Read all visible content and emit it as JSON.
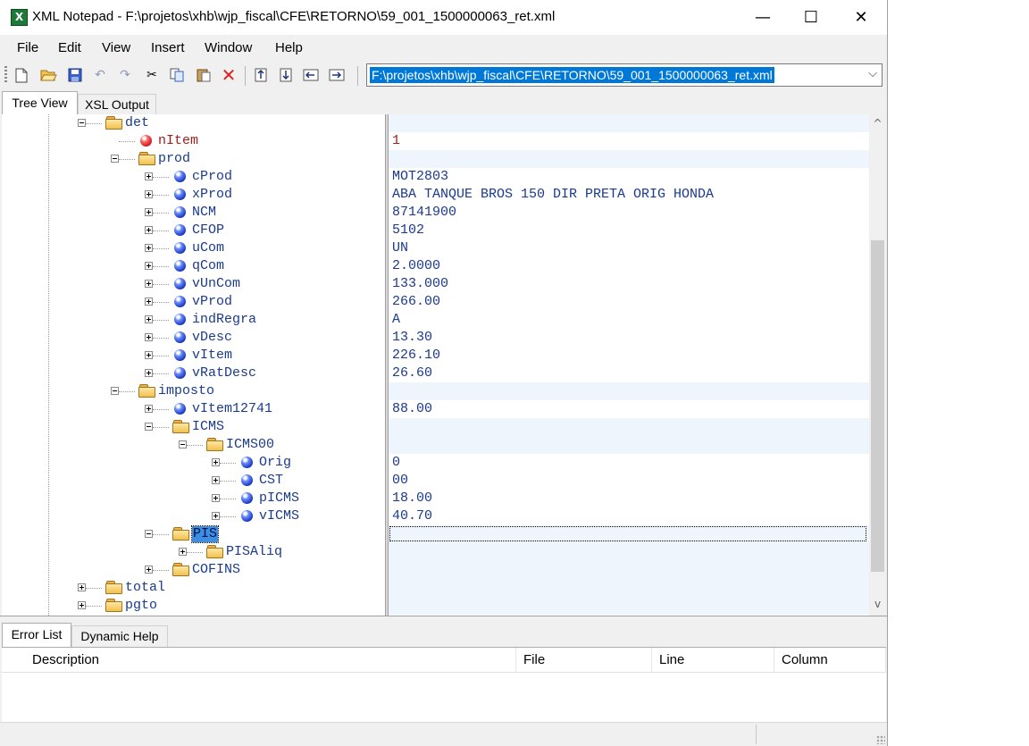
{
  "window": {
    "title": "XML Notepad - F:\\projetos\\xhb\\wjp_fiscal\\CFE\\RETORNO\\59_001_1500000063_ret.xml",
    "app_icon_letter": "X",
    "minimize_glyph": "—",
    "maximize_glyph": "☐",
    "close_glyph": "✕"
  },
  "menu": [
    "File",
    "Edit",
    "View",
    "Insert",
    "Window",
    "Help"
  ],
  "toolbar": {
    "icons": [
      "new-icon",
      "open-icon",
      "save-icon",
      "undo-icon",
      "redo-icon",
      "cut-icon",
      "copy-icon",
      "paste-icon",
      "delete-icon",
      "nudge-up-icon",
      "nudge-down-icon",
      "nudge-left-icon",
      "nudge-right-icon"
    ],
    "location_value": "F:\\projetos\\xhb\\wjp_fiscal\\CFE\\RETORNO\\59_001_1500000063_ret.xml"
  },
  "tabs": {
    "tree_view": "Tree View",
    "xsl_output": "XSL Output"
  },
  "tree": [
    {
      "label": "det",
      "type": "folder",
      "expander": "minus",
      "value": ""
    },
    {
      "label": "nItem",
      "type": "attribute",
      "expander": "none",
      "value": "1"
    },
    {
      "label": "prod",
      "type": "folder",
      "expander": "minus",
      "value": ""
    },
    {
      "label": "cProd",
      "type": "element",
      "expander": "plus",
      "value": "MOT2803"
    },
    {
      "label": "xProd",
      "type": "element",
      "expander": "plus",
      "value": "ABA TANQUE BROS 150 DIR PRETA ORIG HONDA"
    },
    {
      "label": "NCM",
      "type": "element",
      "expander": "plus",
      "value": "87141900"
    },
    {
      "label": "CFOP",
      "type": "element",
      "expander": "plus",
      "value": "5102"
    },
    {
      "label": "uCom",
      "type": "element",
      "expander": "plus",
      "value": "UN"
    },
    {
      "label": "qCom",
      "type": "element",
      "expander": "plus",
      "value": "2.0000"
    },
    {
      "label": "vUnCom",
      "type": "element",
      "expander": "plus",
      "value": "133.000"
    },
    {
      "label": "vProd",
      "type": "element",
      "expander": "plus",
      "value": "266.00"
    },
    {
      "label": "indRegra",
      "type": "element",
      "expander": "plus",
      "value": "A"
    },
    {
      "label": "vDesc",
      "type": "element",
      "expander": "plus",
      "value": "13.30"
    },
    {
      "label": "vItem",
      "type": "element",
      "expander": "plus",
      "value": "226.10"
    },
    {
      "label": "vRatDesc",
      "type": "element",
      "expander": "plus",
      "value": "26.60"
    },
    {
      "label": "imposto",
      "type": "folder",
      "expander": "minus",
      "value": ""
    },
    {
      "label": "vItem12741",
      "type": "element",
      "expander": "plus",
      "value": "88.00"
    },
    {
      "label": "ICMS",
      "type": "folder",
      "expander": "minus",
      "value": ""
    },
    {
      "label": "ICMS00",
      "type": "folder",
      "expander": "minus",
      "value": ""
    },
    {
      "label": "Orig",
      "type": "element",
      "expander": "plus",
      "value": "0"
    },
    {
      "label": "CST",
      "type": "element",
      "expander": "plus",
      "value": "00"
    },
    {
      "label": "pICMS",
      "type": "element",
      "expander": "plus",
      "value": "18.00"
    },
    {
      "label": "vICMS",
      "type": "element",
      "expander": "plus",
      "value": "40.70"
    },
    {
      "label": "PIS",
      "type": "folder",
      "expander": "minus",
      "value": "",
      "selected": true
    },
    {
      "label": "PISAliq",
      "type": "folder",
      "expander": "plus",
      "value": ""
    },
    {
      "label": "COFINS",
      "type": "folder",
      "expander": "plus",
      "value": ""
    },
    {
      "label": "total",
      "type": "folder",
      "expander": "plus",
      "value": ""
    },
    {
      "label": "pgto",
      "type": "folder",
      "expander": "plus",
      "value": ""
    }
  ],
  "bottom_tabs": {
    "error_list": "Error List",
    "dynamic_help": "Dynamic Help"
  },
  "error_columns": [
    "Description",
    "File",
    "Line",
    "Column"
  ],
  "scroll": {
    "up_glyph": "^",
    "down_glyph": "v"
  },
  "colors": {
    "selection": "#3b8ee6",
    "combo_selection": "#0078d7",
    "node_text": "#1a3a8f",
    "attribute_text": "#a61c1c"
  }
}
